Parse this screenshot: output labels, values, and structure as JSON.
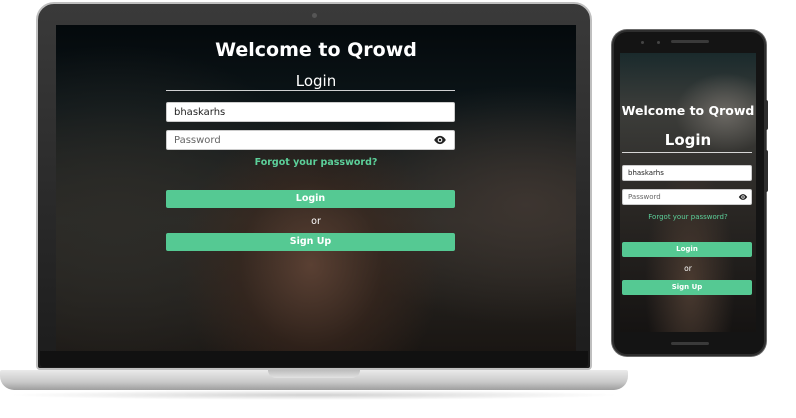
{
  "app_title": "Welcome to Qrowd",
  "login_heading": "Login",
  "username": {
    "value": "bhaskarhs"
  },
  "password": {
    "placeholder": "Password",
    "toggle_icon": "eye-icon"
  },
  "forgot_password_link": "Forgot your password?",
  "login_button": "Login",
  "or_text": "or",
  "signup_button": "Sign Up",
  "colors": {
    "accent": "#55c993",
    "link": "#5cd09a",
    "text": "#ffffff"
  }
}
